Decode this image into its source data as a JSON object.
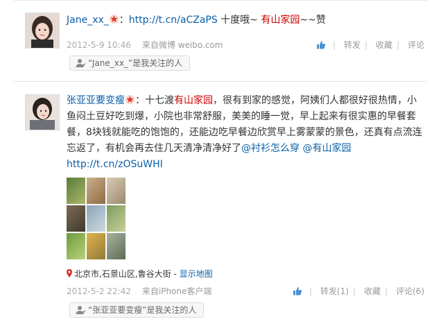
{
  "post1": {
    "author": "Jane_xx_",
    "colon": "：",
    "link": "http://t.cn/aCZaPS",
    "text_mid": " 十度哦~ ",
    "topic": "有山家园",
    "text_end": "~~赞",
    "time": "2012-5-9 10:46",
    "source": "来自微博 weibo.com",
    "actions": {
      "repost": "转发",
      "favorite": "收藏",
      "comment": "评论"
    },
    "follow_tag": "“Jane_xx_”是我关注的人"
  },
  "post2": {
    "author": "张亚亚要变瘦",
    "colon": "：",
    "text_a": "十七渡",
    "topic": "有山家园",
    "text_b": "，很有到家的感觉，阿姨们人都很好很热情，小鱼闷土豆好吃到爆，小院也非常舒服，美美的睡一觉，早上起来有很实惠的早餐套餐，8块钱就能吃的饱饱的，还能边吃早餐边欣赏早上雾蒙蒙的景色，还真有点流连忘返了，有机会再去住几天清净清净好了",
    "mention1": "@衬衫怎么穿",
    "mention2": "@有山家园",
    "link": "http://t.cn/zOSuWHI",
    "location": "北京市,石景山区,鲁谷大街",
    "map_link": "显示地图",
    "location_sep": " - ",
    "time": "2012-5-2 22:42",
    "source": "来自iPhone客户端",
    "actions": {
      "repost": "转发(1)",
      "favorite": "收藏",
      "comment": "评论(6)"
    },
    "follow_tag": "“张亚亚要变瘦”是我关注的人"
  },
  "icons": {
    "vip": "star-badge-icon",
    "like": "thumbs-up-icon",
    "follow": "person-icon",
    "location": "map-pin-icon"
  },
  "colors": {
    "link": "#0a5fa8",
    "topic_red": "#cc0000",
    "meta_gray": "#999999"
  }
}
